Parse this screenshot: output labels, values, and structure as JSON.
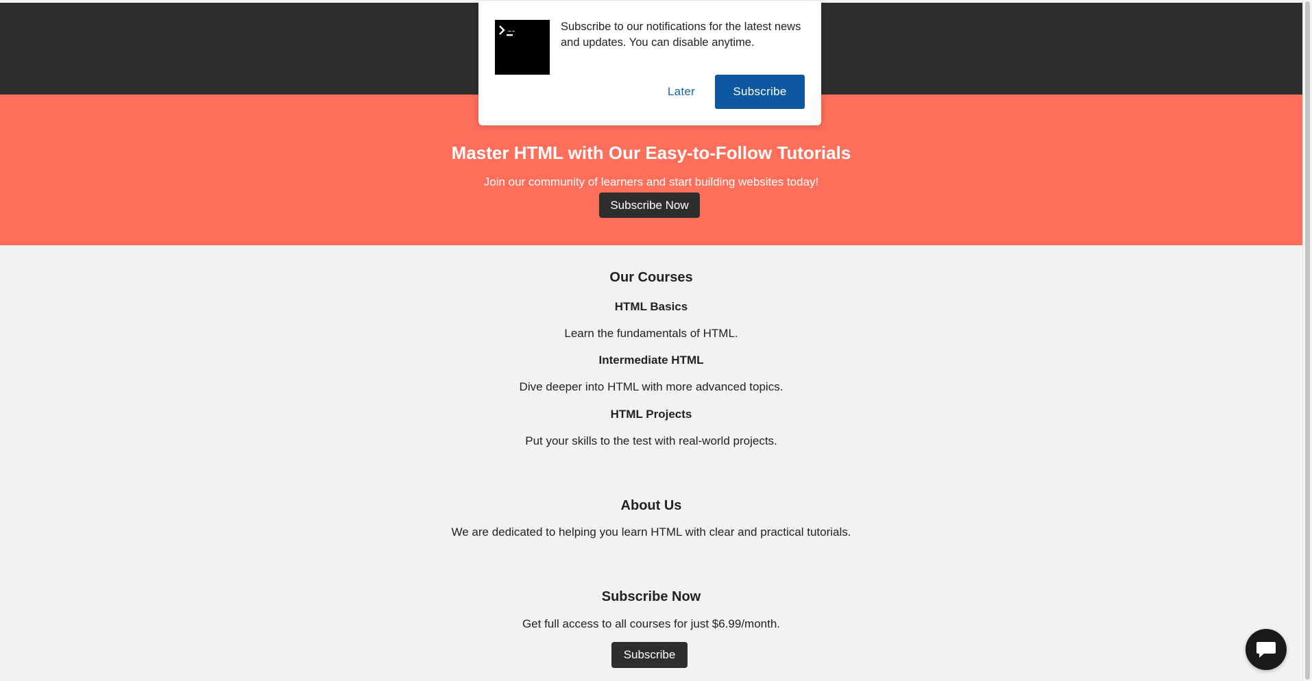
{
  "hero": {
    "title": "Master HTML with Our Easy-to-Follow Tutorials",
    "subtitle": "Join our community of learners and start building websites today!",
    "button_label": "Subscribe Now"
  },
  "courses": {
    "heading": "Our Courses",
    "items": [
      {
        "title": "HTML Basics",
        "description": "Learn the fundamentals of HTML."
      },
      {
        "title": "Intermediate HTML",
        "description": "Dive deeper into HTML with more advanced topics."
      },
      {
        "title": "HTML Projects",
        "description": "Put your skills to the test with real-world projects."
      }
    ]
  },
  "about": {
    "heading": "About Us",
    "text": "We are dedicated to helping you learn HTML with clear and practical tutorials."
  },
  "subscribe": {
    "heading": "Subscribe Now",
    "text": "Get full access to all courses for just $6.99/month.",
    "button_label": "Subscribe"
  },
  "notification_popup": {
    "message": "Subscribe to our notifications for the latest news and updates. You can disable anytime.",
    "later_label": "Later",
    "subscribe_label": "Subscribe",
    "logo_icon": "terminal-icon"
  },
  "chat_widget": {
    "icon": "chat-icon"
  },
  "colors": {
    "header_bg": "#2e2e2e",
    "hero_bg": "#fe6f5b",
    "page_bg": "#f2f2f2",
    "popup_subscribe_bg": "#0d58a1",
    "popup_later_text": "#1a62ad",
    "chat_button_bg": "#1a1a1a"
  }
}
